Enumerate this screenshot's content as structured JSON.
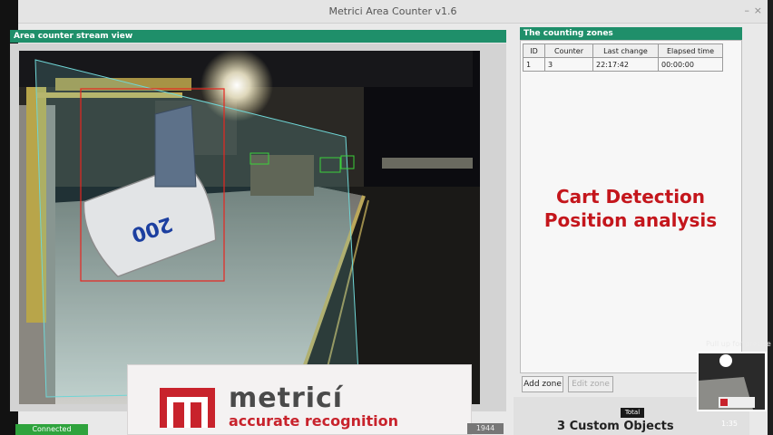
{
  "window": {
    "title": "Metrici Area Counter v1.6"
  },
  "stream_panel": {
    "title": "Area counter stream view"
  },
  "zones_panel": {
    "title": "The counting zones",
    "columns": [
      "ID",
      "Counter",
      "Last change",
      "Elapsed time"
    ],
    "rows": [
      {
        "id": "1",
        "counter": "3",
        "last_change": "22:17:42",
        "elapsed": "00:00:00"
      }
    ]
  },
  "overlay": {
    "line1": "Cart Detection",
    "line2": "Position analysis"
  },
  "buttons": {
    "add_zone": "Add zone",
    "edit_zone": "Edit zone"
  },
  "status": {
    "label": "Connected",
    "color": "#2fa33d"
  },
  "totals": {
    "badge": "Total",
    "summary": "3 Custom Objects"
  },
  "video_player": {
    "time": "1:35",
    "popup": "Pull up for precise",
    "frame_label": "1944"
  },
  "logo": {
    "word": "metricí",
    "tagline": "accurate recognition",
    "color": "#c8232c"
  },
  "cart": {
    "number": "200"
  },
  "accent_color": "#1f8f6a"
}
